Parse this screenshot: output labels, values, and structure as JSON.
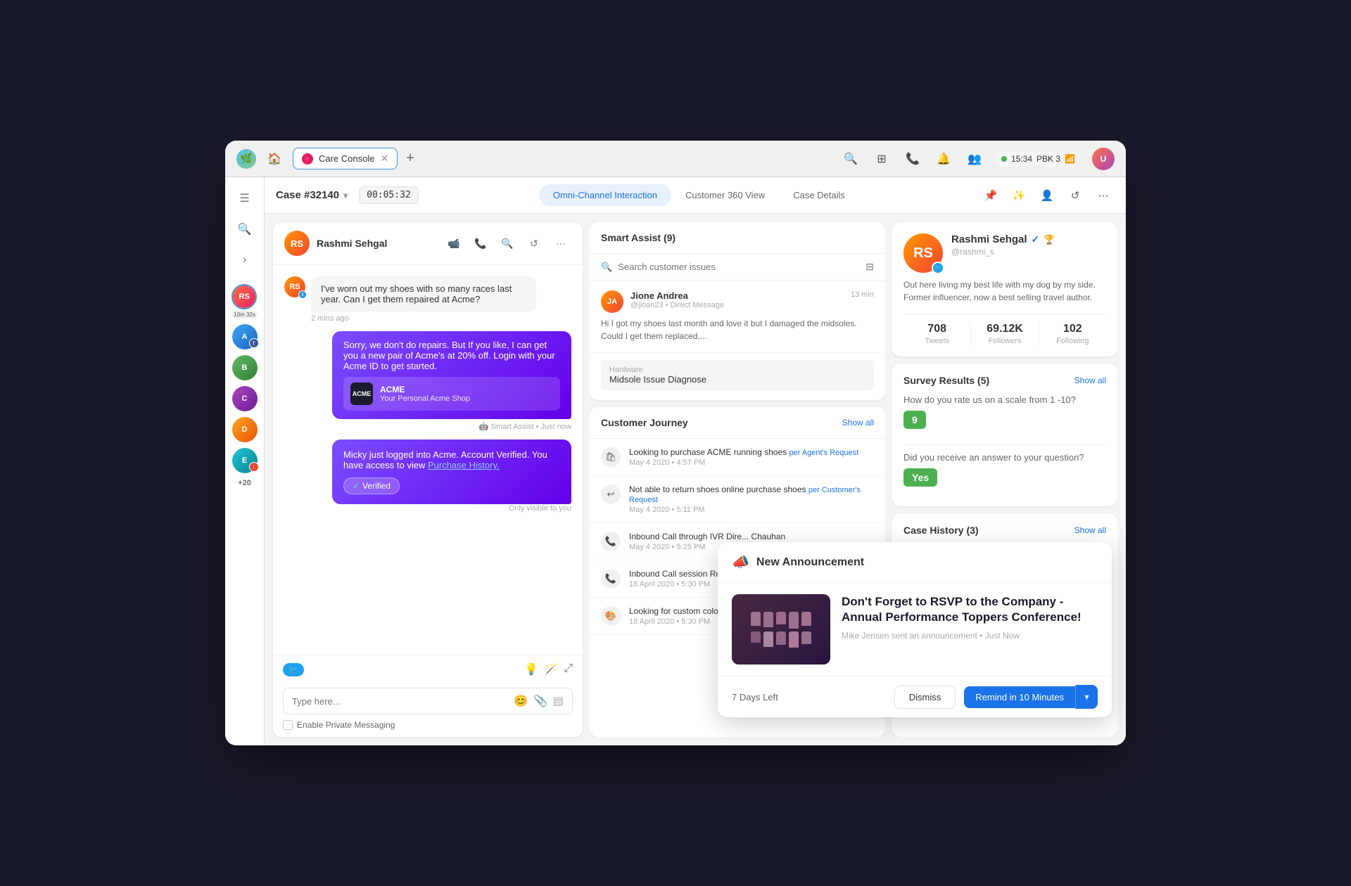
{
  "browser": {
    "logo": "🌿",
    "tab_label": "Care Console",
    "tab_icon": "💗",
    "add_tab": "+",
    "status_time": "15:34",
    "status_group": "PBK 3",
    "actions": {
      "search": "🔍",
      "grid": "⊞",
      "phone": "📞",
      "bell": "🔔",
      "people": "👥"
    }
  },
  "case_header": {
    "case_number": "Case #32140",
    "timer": "00:05:32",
    "tabs": [
      {
        "label": "Omni-Channel Interaction",
        "active": true
      },
      {
        "label": "Customer 360 View",
        "active": false
      },
      {
        "label": "Case Details",
        "active": false
      }
    ]
  },
  "chat": {
    "user_name": "Rashmi Sehgal",
    "messages": [
      {
        "type": "received",
        "text": "I've worn out my shoes with so many races last year. Can I get them repaired at Acme?",
        "time": "2 mins ago"
      },
      {
        "type": "sent",
        "text": "Sorry, we don't do repairs. But If you like, I can get you a new pair of Acme's at 20% off. Login with your Acme ID to get started.",
        "has_card": true,
        "card_brand": "ACME",
        "card_tagline": "Your Personal Acme Shop",
        "meta": "Smart Assist • Just now"
      },
      {
        "type": "sent_verified",
        "text": "Micky just logged into Acme. Account Verified. You have access to view",
        "link_text": "Purchase History.",
        "badge_text": "Verified",
        "meta": "Only visible to you"
      }
    ],
    "footer_placeholder": "Type here...",
    "private_messaging_label": "Enable Private Messaging"
  },
  "smart_assist": {
    "title": "Smart Assist (9)",
    "search_placeholder": "Search customer issues",
    "issue": {
      "user_name": "Jione Andrea",
      "handle": "@jioan23 • Direct Message",
      "time": "13 min",
      "text": "Hi I got my shoes last month and love it but I damaged the midsoles. Could I get them replaced,...",
      "tag_label": "Hardware",
      "tag_value": "Midsole Issue Diagnose"
    }
  },
  "customer_journey": {
    "title": "Customer Journey",
    "show_all": "Show all",
    "items": [
      {
        "icon": "🛍",
        "title": "Looking to purchase ACME running shoes",
        "channel": "per Agent's Request",
        "date": "May 4 2020 • 4:57 PM"
      },
      {
        "icon": "↩",
        "title": "Not able to return shoes online purchase shoes",
        "channel": "per Customer's Request",
        "date": "May 4 2020 • 5:11 PM"
      },
      {
        "icon": "📞",
        "title": "Inbound Call through IVR Dire... Chauhan",
        "channel": "",
        "date": "May 4 2020 • 5:25 PM"
      },
      {
        "icon": "📞",
        "title": "Inbound Call session Recorded...",
        "channel": "",
        "date": "18 April 2020 • 5:30 PM"
      },
      {
        "icon": "🎨",
        "title": "Looking for custom color opti... Customer's Request",
        "channel": "",
        "date": "18 April 2020 • 5:30 PM"
      }
    ]
  },
  "profile": {
    "name": "Rashmi Sehgal",
    "handle": "@rashmi_s",
    "bio": "Out here living my best life with my dog by my side. Former influencer, now a best selling travel author.",
    "stats": {
      "tweets": {
        "value": "708",
        "label": "Tweets"
      },
      "followers": {
        "value": "69.12K",
        "label": "Followers"
      },
      "following": {
        "value": "102",
        "label": "Following"
      }
    }
  },
  "survey": {
    "title": "Survey Results (5)",
    "show_all": "Show all",
    "questions": [
      {
        "question": "How do you rate us on a scale from 1 -10?",
        "answer": "9"
      },
      {
        "question": "Did you receive an answer to your question?",
        "answer": "Yes"
      }
    ]
  },
  "case_history": {
    "title": "Case History (3)",
    "show_all": "Show all"
  },
  "announcement": {
    "title": "New Announcement",
    "headline": "Don't Forget to RSVP to the Company - Annual Performance Toppers Conference!",
    "meta": "Mike Jensen sent an announcement • Just Now",
    "days_left": "7 Days Left",
    "dismiss_label": "Dismiss",
    "remind_label": "Remind in 10 Minutes"
  },
  "sidebar": {
    "icons": [
      "☰",
      "🔍",
      "›"
    ],
    "avatars": [
      {
        "initials": "RS",
        "active": true,
        "timer": "10m 32s",
        "badge": ""
      },
      {
        "initials": "A",
        "active": false,
        "timer": "",
        "badge": "f"
      },
      {
        "initials": "B",
        "active": false,
        "timer": "",
        "badge": ""
      },
      {
        "initials": "C",
        "active": false,
        "timer": "",
        "badge": ""
      },
      {
        "initials": "D",
        "active": false,
        "timer": "",
        "badge": ""
      },
      {
        "initials": "E",
        "active": false,
        "timer": "",
        "badge": ""
      },
      {
        "more": "+20"
      }
    ]
  }
}
